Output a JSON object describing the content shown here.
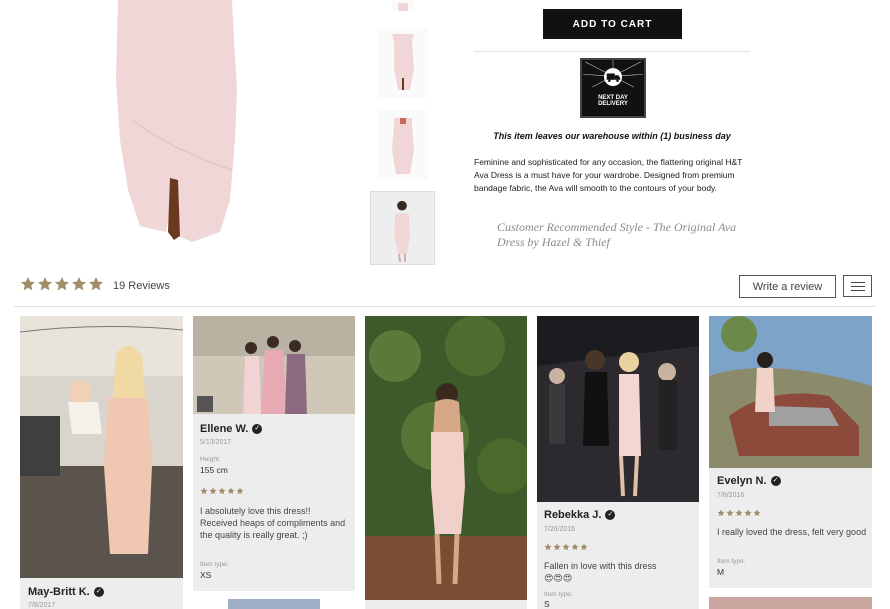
{
  "product": {
    "add_to_cart": "ADD TO CART",
    "badge_line1": "NEXT",
    "badge_line2": "DAY",
    "badge_line3": "NEXT DAY",
    "badge_line4": "DELIVERY",
    "ship_note": "This item leaves our warehouse within (1) business day",
    "description": "Feminine and sophisticated for any occasion, the flattering original H&T Ava Dress is a must have for your wardrobe. Designed from premium bandage fabric, the Ava will smooth to the contours of your body.",
    "recommended": "Customer Recommended Style - The Original Ava Dress by Hazel & Thief"
  },
  "reviews": {
    "rating_stars": 5,
    "count_label": "19 Reviews",
    "write_review": "Write a review",
    "colors": {
      "star": "#a38c6a",
      "dress": "#f1d3d3"
    },
    "cards": [
      {
        "name": "May-Britt K.",
        "date": "7/6/2017"
      },
      {
        "name": "Ellene W.",
        "date": "5/13/2017",
        "height_label": "Height:",
        "height": "155 cm",
        "text": "I absolutely love this dress!! Received heaps of compliments and the quality is really great. ;)",
        "item_type_label": "Item type:",
        "item_type": "XS"
      },
      {
        "name": ""
      },
      {
        "name": "Rebekka J.",
        "date": "7/26/2016",
        "text": "Fallen in love with this dress",
        "emoji": "😍😍😍",
        "item_type_label": "Item type:",
        "item_type": "S"
      },
      {
        "name": "Evelyn N.",
        "date": "7/8/2016",
        "text": "I really loved the dress, felt very good",
        "item_type_label": "Item type:",
        "item_type": "M"
      }
    ]
  }
}
